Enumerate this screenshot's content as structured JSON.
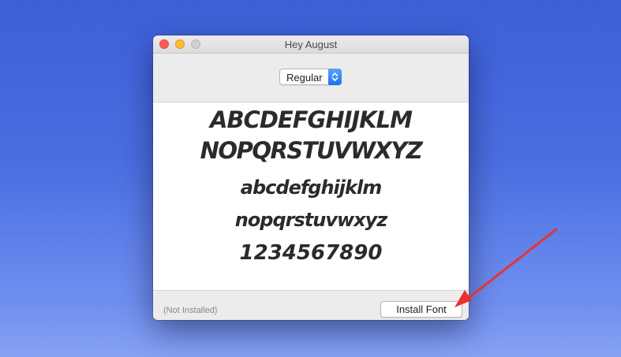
{
  "window": {
    "title": "Hey August"
  },
  "toolbar": {
    "style_select": {
      "selected": "Regular"
    }
  },
  "preview": {
    "lines": [
      "ABCDEFGHIJKLM",
      "NOPQRSTUVWXYZ",
      "abcdefghijklm",
      "nopqrstuvwxyz",
      "1234567890"
    ]
  },
  "footer": {
    "status": "(Not Installed)",
    "install_label": "Install Font"
  },
  "colors": {
    "annotation_arrow": "#e8322d",
    "select_accent": "#2a7cf3",
    "close": "#fc5f57",
    "minimize": "#fdbc2e"
  },
  "icons": {
    "select_stepper": "up-down-chevron-icon",
    "annotation": "red-arrow-icon"
  }
}
